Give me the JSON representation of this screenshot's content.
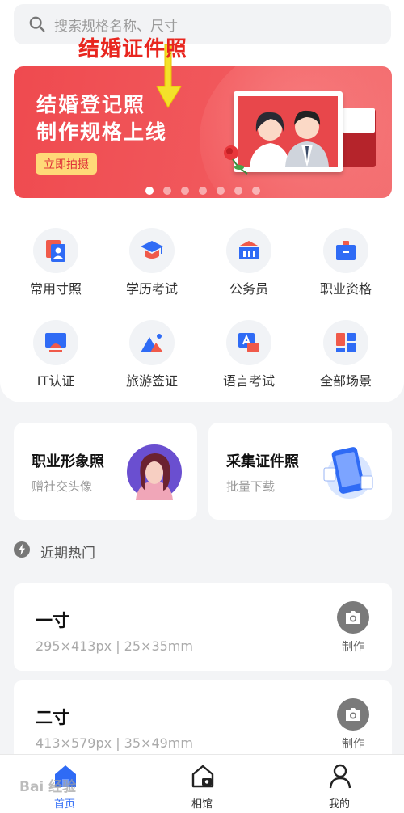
{
  "search": {
    "placeholder": "搜索规格名称、尺寸"
  },
  "annotation": {
    "text": "结婚证件照"
  },
  "banner": {
    "line1": "结婚登记照",
    "line2": "制作规格上线",
    "button": "立即拍摄",
    "dots_count": 7,
    "active_dot": 0
  },
  "grid": [
    {
      "label": "常用寸照",
      "icon": "portrait-icon"
    },
    {
      "label": "学历考试",
      "icon": "graduation-cap-icon"
    },
    {
      "label": "公务员",
      "icon": "government-building-icon"
    },
    {
      "label": "职业资格",
      "icon": "briefcase-icon"
    },
    {
      "label": "IT认证",
      "icon": "monitor-icon"
    },
    {
      "label": "旅游签证",
      "icon": "mountain-icon"
    },
    {
      "label": "语言考试",
      "icon": "language-icon"
    },
    {
      "label": "全部场景",
      "icon": "all-scenes-icon"
    }
  ],
  "cards": [
    {
      "title": "职业形象照",
      "subtitle": "赠社交头像"
    },
    {
      "title": "采集证件照",
      "subtitle": "批量下载"
    }
  ],
  "hot": {
    "title": "近期热门"
  },
  "sizes": [
    {
      "name": "一寸",
      "spec": "295×413px | 25×35mm",
      "action": "制作"
    },
    {
      "name": "二寸",
      "spec": "413×579px | 35×49mm",
      "action": "制作"
    }
  ],
  "tabs": [
    {
      "label": "首页",
      "icon": "home-icon",
      "active": true
    },
    {
      "label": "相馆",
      "icon": "studio-icon",
      "active": false
    },
    {
      "label": "我的",
      "icon": "user-icon",
      "active": false
    }
  ],
  "watermark": "Bai 经验",
  "colors": {
    "primary": "#2f6bf5",
    "banner": "#ef4a4f",
    "annotation": "#e8261f",
    "button_yellow": "#ffd978"
  }
}
